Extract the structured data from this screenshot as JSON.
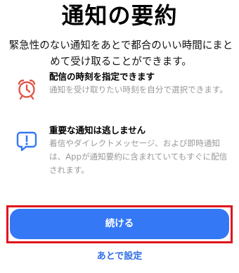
{
  "title": "通知の要約",
  "subtitle": "緊急性のない通知をあとで都合のいい時間にまとめて受け取ることができます。",
  "features": [
    {
      "icon": "alarm-clock-icon",
      "title": "配信の時刻を指定できます",
      "description": "通知を受け取りたい時刻を自分で選択できます。"
    },
    {
      "icon": "exclamation-speech-bubble-icon",
      "title": "重要な通知は逃しません",
      "description": "着信やダイレクトメッセージ、および即時通知は、Appが通知要約に含まれていてもすぐに配信されます。"
    }
  ],
  "buttons": {
    "continue": "続ける",
    "later": "あとで設定"
  },
  "colors": {
    "accent": "#3478f6",
    "link": "#2f6fe6",
    "clock_icon": "#e0584a",
    "bubble_icon": "#3478f6",
    "highlight": "#e0151d",
    "muted_text": "#999999"
  }
}
